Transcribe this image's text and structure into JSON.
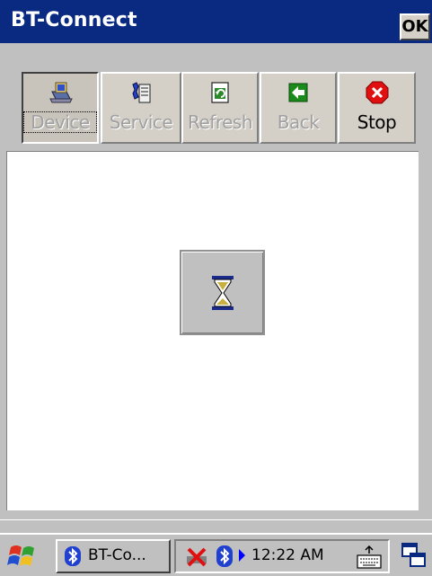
{
  "window": {
    "title": "BT-Connect",
    "ok_label": "OK"
  },
  "toolbar": {
    "buttons": [
      {
        "label": "Device",
        "icon": "device-laptop-icon",
        "state": "pressed-disabled"
      },
      {
        "label": "Service",
        "icon": "service-icon",
        "state": "disabled"
      },
      {
        "label": "Refresh",
        "icon": "refresh-icon",
        "state": "disabled"
      },
      {
        "label": "Back",
        "icon": "back-arrow-icon",
        "state": "disabled"
      },
      {
        "label": "Stop",
        "icon": "stop-icon",
        "state": "enabled"
      }
    ]
  },
  "content": {
    "busy_indicator": "hourglass-icon"
  },
  "taskbar": {
    "start_icon": "windows-flag-icon",
    "task_label": "BT-Co...",
    "tray": {
      "icons": [
        "disconnected-network-icon",
        "bluetooth-icon"
      ],
      "clock": "12:22 AM"
    },
    "keyboard_icon": "keyboard-icon",
    "switcher_icon": "window-switch-icon"
  },
  "colors": {
    "titlebar": "#0a2a82",
    "face": "#c0c0c0",
    "content_bg": "#ffffff",
    "disabled_text": "#a0a0a0"
  }
}
